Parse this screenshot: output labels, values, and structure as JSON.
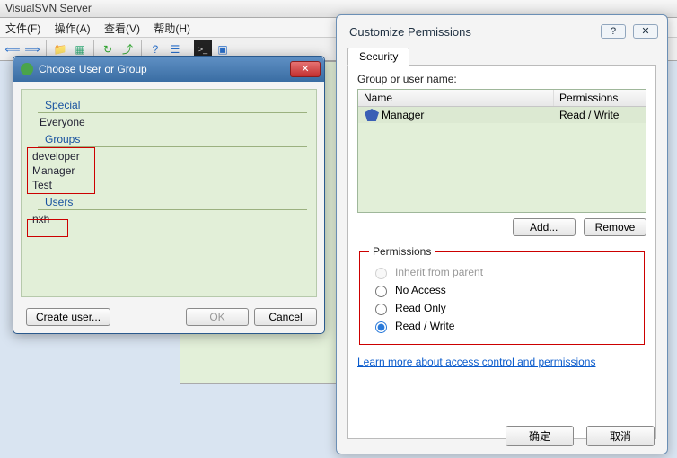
{
  "main_window": {
    "title": "VisualSVN Server"
  },
  "menu": {
    "file": "文件(F)",
    "action": "操作(A)",
    "view": "查看(V)",
    "help": "帮助(H)"
  },
  "toolbar_icons": [
    "←",
    "→",
    "folder",
    "tree",
    "↻",
    "↺",
    "?",
    "☰",
    "▣",
    "◼",
    "▤"
  ],
  "choose_dialog": {
    "title": "Choose User or Group",
    "sections": {
      "special": "Special",
      "groups": "Groups",
      "users": "Users"
    },
    "special_items": [
      "Everyone"
    ],
    "groups_items": [
      "developer",
      "Manager",
      "Test"
    ],
    "users_items": [
      "nxh"
    ],
    "create_user": "Create user...",
    "ok": "OK",
    "cancel": "Cancel"
  },
  "perm_dialog": {
    "title": "Customize Permissions",
    "tab": "Security",
    "group_label": "Group or user name:",
    "cols": {
      "name": "Name",
      "perm": "Permissions"
    },
    "rows": [
      {
        "name": "Manager",
        "perm": "Read / Write"
      }
    ],
    "add": "Add...",
    "remove": "Remove",
    "perms_legend": "Permissions",
    "radios": {
      "inherit": "Inherit from parent",
      "noaccess": "No Access",
      "readonly": "Read Only",
      "readwrite": "Read / Write"
    },
    "link": "Learn more about access control and permissions",
    "ok": "确定",
    "cancel": "取消"
  }
}
